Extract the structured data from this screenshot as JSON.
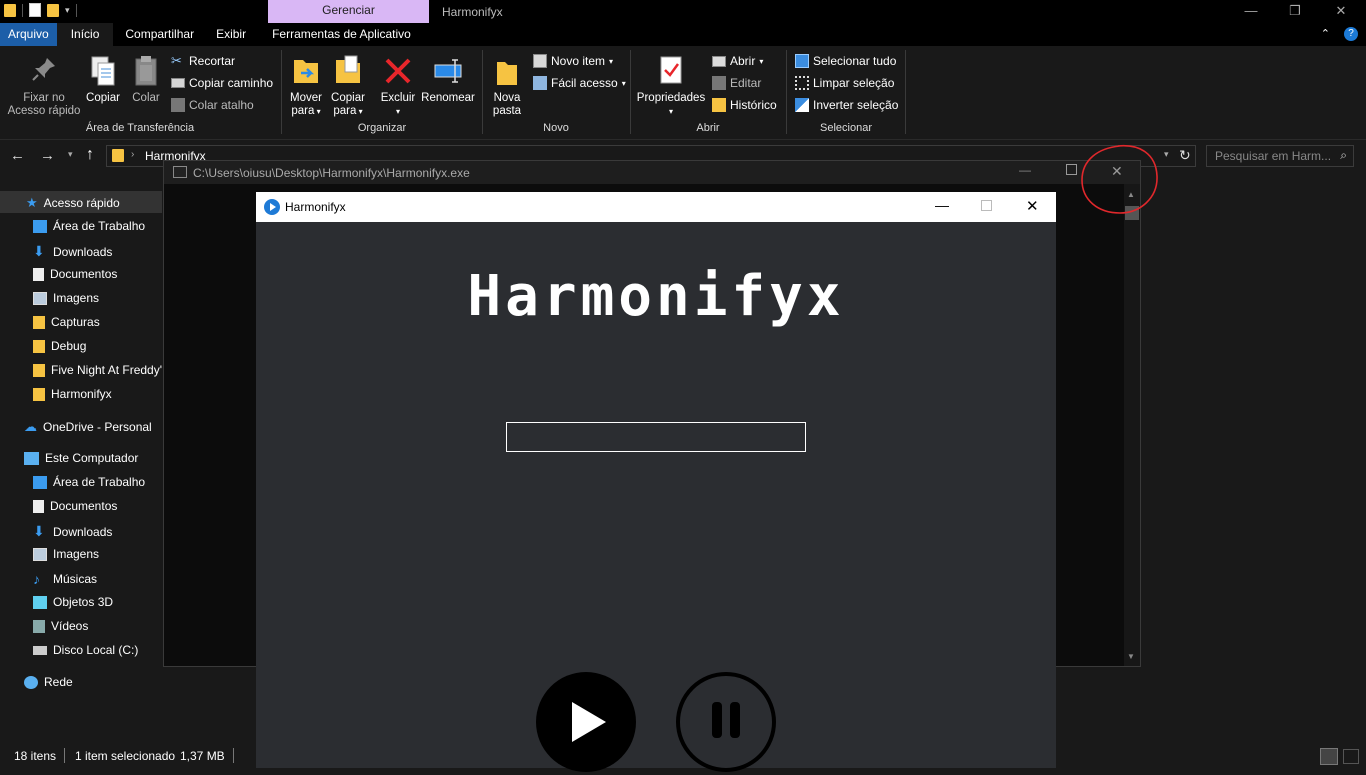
{
  "explorer": {
    "ribbon_context_tab": "Gerenciar",
    "window_title": "Harmonifyx",
    "tabs": [
      "Arquivo",
      "Início",
      "Compartilhar",
      "Exibir",
      "Ferramentas de Aplicativo"
    ],
    "ribbon": {
      "clipboard": {
        "pin_label_1": "Fixar no",
        "pin_label_2": "Acesso rápido",
        "copy": "Copiar",
        "paste": "Colar",
        "cut": "Recortar",
        "copy_path": "Copiar caminho",
        "paste_shortcut": "Colar atalho",
        "group": "Área de Transferência"
      },
      "organize": {
        "move_1": "Mover",
        "move_2": "para",
        "copy_1": "Copiar",
        "copy_2": "para",
        "delete": "Excluir",
        "rename": "Renomear",
        "group": "Organizar"
      },
      "new": {
        "new_folder_1": "Nova",
        "new_folder_2": "pasta",
        "new_item": "Novo item",
        "easy_access": "Fácil acesso",
        "group": "Novo"
      },
      "open": {
        "properties": "Propriedades",
        "open": "Abrir",
        "edit": "Editar",
        "history": "Histórico",
        "group": "Abrir"
      },
      "select": {
        "select_all": "Selecionar tudo",
        "select_none": "Limpar seleção",
        "invert": "Inverter seleção",
        "group": "Selecionar"
      }
    },
    "address_path": "Harmonifyx",
    "search_placeholder": "Pesquisar em Harm...",
    "nav": {
      "quick_access": "Acesso rápido",
      "quick_items": [
        "Área de Trabalho",
        "Downloads",
        "Documentos",
        "Imagens",
        "Capturas",
        "Debug",
        "Five Night At Freddy'",
        "Harmonifyx"
      ],
      "onedrive": "OneDrive - Personal",
      "this_pc": "Este Computador",
      "pc_items": [
        "Área de Trabalho",
        "Documentos",
        "Downloads",
        "Imagens",
        "Músicas",
        "Objetos 3D",
        "Vídeos",
        "Disco Local (C:)"
      ],
      "network": "Rede"
    },
    "status": {
      "items": "18 itens",
      "selected": "1 item selecionado",
      "size": "1,37 MB"
    }
  },
  "console": {
    "title": "C:\\Users\\oiusu\\Desktop\\Harmonifyx\\Harmonifyx.exe"
  },
  "app": {
    "title": "Harmonifyx",
    "logo_text": "Harmonifyx",
    "url_input_value": ""
  },
  "colors": {
    "accent": "#1c5ea8",
    "context_tab": "#d9b7f5",
    "app_bg": "#2b2d31",
    "annotation": "#e0282c"
  }
}
